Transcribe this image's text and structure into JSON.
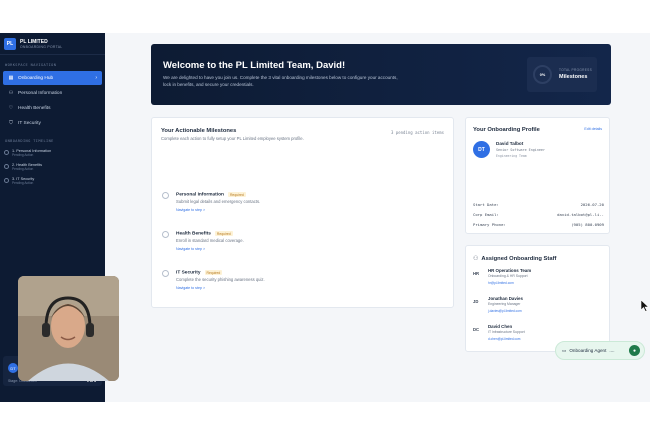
{
  "brand": {
    "logo": "PL",
    "title": "PL LIMITED",
    "subtitle": "ONBOARDING PORTAL"
  },
  "sidebar": {
    "nav_label": "WORKSPACE NAVIGATION",
    "items": [
      {
        "label": "Onboarding Hub",
        "icon": "grid-icon",
        "active": true
      },
      {
        "label": "Personal Information",
        "icon": "user-icon"
      },
      {
        "label": "Health Benefits",
        "icon": "heart-icon"
      },
      {
        "label": "IT Security",
        "icon": "shield-icon"
      }
    ],
    "timeline_label": "ONBOARDING TIMELINE",
    "timeline": [
      {
        "title": "1. Personal Information",
        "status": "Pending Action"
      },
      {
        "title": "2. Health Benefits",
        "status": "Pending Action"
      },
      {
        "title": "3. IT Security",
        "status": "Pending Action"
      }
    ],
    "user": {
      "initials": "DT",
      "stage": "Stage: Onboarded",
      "count": "0 of 3"
    }
  },
  "hero": {
    "title": "Welcome to the PL Limited Team, David!",
    "description": "We are delighted to have you join us. Complete the 3 vital onboarding milestones below to configure your accounts, lock in benefits, and secure your credentials.",
    "progress_ring": "0%",
    "progress_label": "TOTAL PROGRESS",
    "progress_value": "Milestones"
  },
  "milestones": {
    "title": "Your Actionable Milestones",
    "subtitle": "Complete each action to fully setup your PL Limited employee system profile.",
    "pending": "3 pending action items",
    "items": [
      {
        "name": "Personal Information",
        "badge": "Required",
        "desc": "Submit legal details and emergency contacts.",
        "link": "Navigate to step >"
      },
      {
        "name": "Health Benefits",
        "badge": "Required",
        "desc": "Enroll in standard medical coverage.",
        "link": "Navigate to step >"
      },
      {
        "name": "IT Security",
        "badge": "Required",
        "desc": "Complete the security phishing awareness quiz.",
        "link": "Navigate to step >"
      }
    ]
  },
  "profile": {
    "title": "Your Onboarding Profile",
    "edit": "Edit details",
    "initials": "DT",
    "name": "David Talbot",
    "role": "Senior Software Engineer",
    "team": "Engineering Team",
    "fields": [
      {
        "key": "Start Date:",
        "value": "2026-07-20"
      },
      {
        "key": "Corp Email:",
        "value": "david.talbot@pl-li.."
      },
      {
        "key": "Primary Phone:",
        "value": "(905) 800-0909"
      }
    ]
  },
  "staff": {
    "title": "Assigned Onboarding Staff",
    "people": [
      {
        "initials": "HR",
        "name": "HR Operations Team",
        "role": "Onboarding & HR Support",
        "email": "hr@pl-limited.com"
      },
      {
        "initials": "JD",
        "name": "Jonathan Davies",
        "role": "Engineering Manager",
        "email": "j.davies@pl-limited.com"
      },
      {
        "initials": "DC",
        "name": "David Chen",
        "role": "IT Infrastructure Support",
        "email": "d.chen@pl-limited.com"
      }
    ]
  },
  "agent": {
    "label": "Onboarding Agent",
    "dots": "...."
  }
}
